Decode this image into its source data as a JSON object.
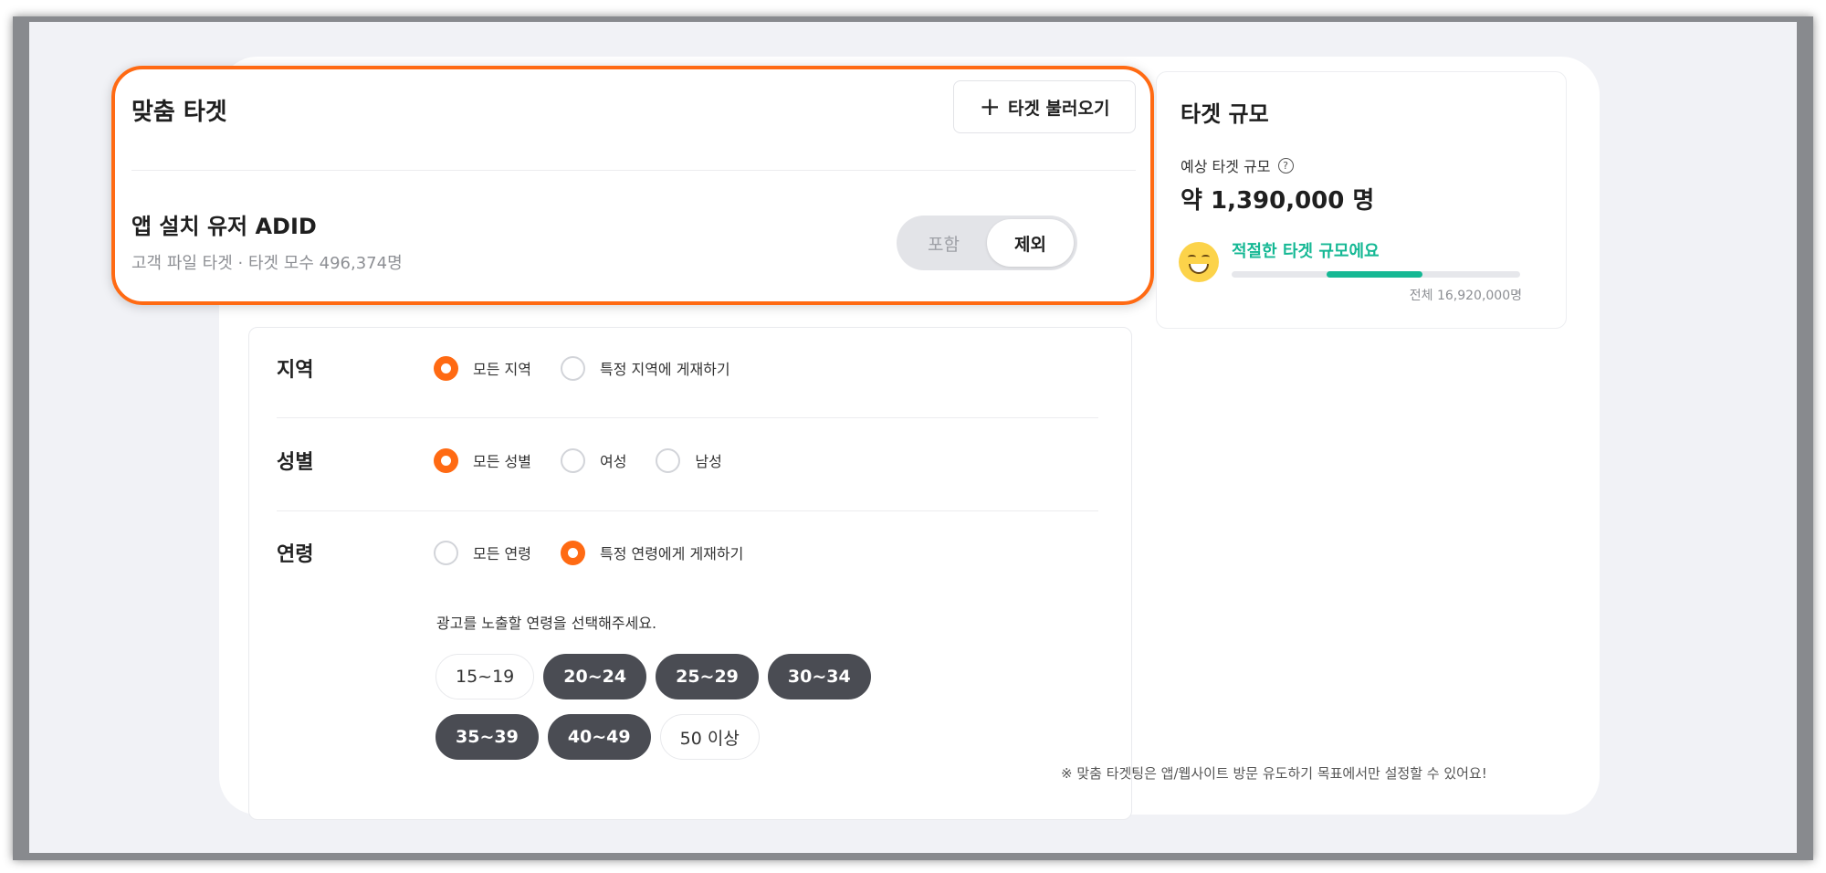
{
  "custom_target": {
    "title": "맞춤 타겟",
    "load_button": "타겟 불러오기",
    "audience_name": "앱 설치 유저 ADID",
    "audience_desc": "고객 파일 타겟 · 타겟 모수 496,374명",
    "toggle": {
      "options": [
        "포함",
        "제외"
      ],
      "selected": "제외"
    }
  },
  "target_size": {
    "title": "타겟 규모",
    "estimate_label": "예상 타겟 규모",
    "estimate_value": "약 1,390,000 명",
    "status": "적절한 타겟 규모에요",
    "range_start": 0.33,
    "range_end": 0.66,
    "total": "전체 16,920,000명"
  },
  "filters": {
    "region": {
      "label": "지역",
      "options": [
        {
          "label": "모든 지역",
          "selected": true
        },
        {
          "label": "특정 지역에 게재하기",
          "selected": false
        }
      ]
    },
    "gender": {
      "label": "성별",
      "options": [
        {
          "label": "모든 성별",
          "selected": true
        },
        {
          "label": "여성",
          "selected": false
        },
        {
          "label": "남성",
          "selected": false
        }
      ]
    },
    "age": {
      "label": "연령",
      "options": [
        {
          "label": "모든 연령",
          "selected": false
        },
        {
          "label": "특정 연령에게 게재하기",
          "selected": true
        }
      ],
      "hint": "광고를 노출할 연령을 선택해주세요.",
      "chips": [
        {
          "label": "15~19",
          "selected": false
        },
        {
          "label": "20~24",
          "selected": true
        },
        {
          "label": "25~29",
          "selected": true
        },
        {
          "label": "30~34",
          "selected": true
        },
        {
          "label": "35~39",
          "selected": true
        },
        {
          "label": "40~49",
          "selected": true
        },
        {
          "label": "50 이상",
          "selected": false
        }
      ]
    }
  },
  "footnote": "※ 맞춤 타겟팅은 앱/웹사이트 방문 유도하기 목표에서만 설정할 수 있어요!",
  "colors": {
    "accent": "#ff6a13",
    "success": "#15b894",
    "chip_selected": "#4a4c53"
  }
}
